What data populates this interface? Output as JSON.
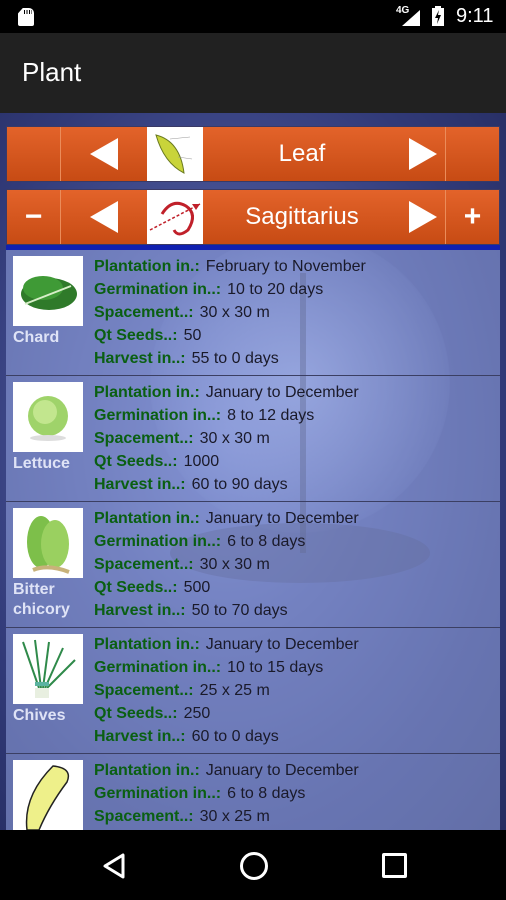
{
  "status_bar": {
    "network": "4G",
    "time": "9:11"
  },
  "app_bar": {
    "title": "Plant"
  },
  "category_selector": {
    "label": "Leaf",
    "icon": "leaf-diagram-icon",
    "prev_icon": "arrow-left-icon",
    "next_icon": "arrow-right-icon"
  },
  "zodiac_selector": {
    "label": "Sagittarius",
    "icon": "sagittarius-icon",
    "minus_label": "−",
    "plus_label": "+"
  },
  "field_labels": {
    "plantation": "Plantation in.:",
    "germination": "Germination in..:",
    "spacement": "Spacement..:",
    "qt_seeds": "Qt Seeds..:",
    "harvest": "Harvest in..:"
  },
  "plants": [
    {
      "name": "Chard",
      "image": "chard-image",
      "plantation": "February to November",
      "germination": "10 to 20 days",
      "spacement": "30 x 30 m",
      "qt_seeds": "50",
      "harvest": "55 to 0 days"
    },
    {
      "name": "Lettuce",
      "image": "lettuce-image",
      "plantation": "January to December",
      "germination": "8 to 12 days",
      "spacement": "30 x 30 m",
      "qt_seeds": "1000",
      "harvest": "60 to 90 days"
    },
    {
      "name": "Bitter chicory",
      "image": "bitter-chicory-image",
      "plantation": "January to December",
      "germination": "6 to 8 days",
      "spacement": "30 x 30 m",
      "qt_seeds": "500",
      "harvest": "50 to 70 days"
    },
    {
      "name": "Chives",
      "image": "chives-image",
      "plantation": "January to December",
      "germination": "10 to 15 days",
      "spacement": "25 x 25 m",
      "qt_seeds": "250",
      "harvest": "60 to 0 days"
    },
    {
      "name": "",
      "image": "endive-image",
      "plantation": "January to December",
      "germination": "6 to 8 days",
      "spacement": "30 x 25 m",
      "qt_seeds": "",
      "harvest": ""
    }
  ],
  "colors": {
    "bar_orange": "#d9571e",
    "label_green": "#0a5f12",
    "underline_blue": "#1020b0"
  }
}
